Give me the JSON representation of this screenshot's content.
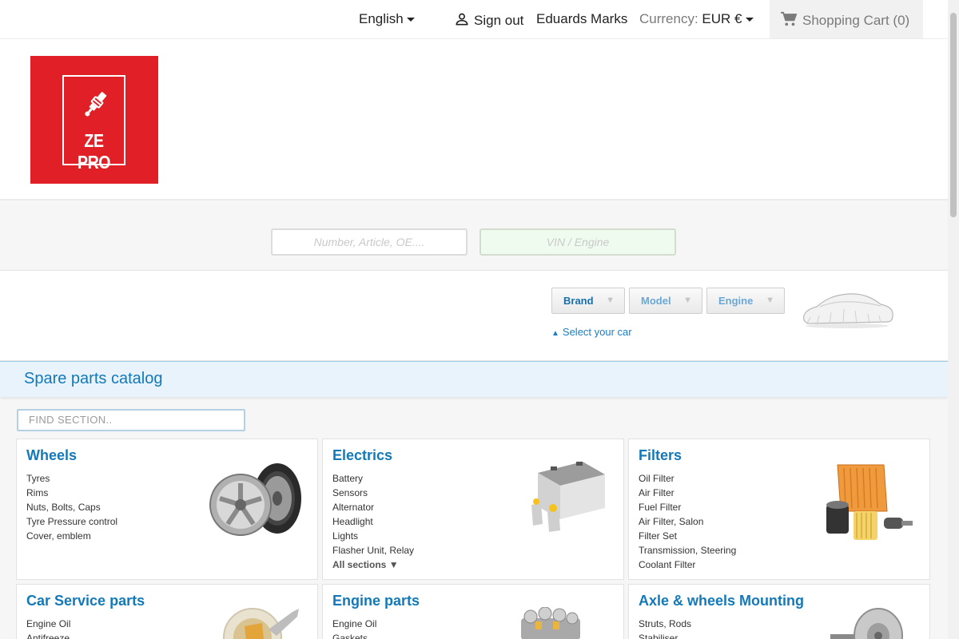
{
  "topbar": {
    "language": "English",
    "sign_out": "Sign out",
    "user_name": "Eduards Marks",
    "currency_label": "Currency:",
    "currency_value": "EUR €",
    "cart": "Shopping Cart (0)"
  },
  "logo": {
    "text": "ZE PRO",
    "bg_color": "#e01f26"
  },
  "search": {
    "number_placeholder": "Number, Article, OE....",
    "vin_placeholder": "VIN / Engine"
  },
  "car_selector": {
    "brand": "Brand",
    "model": "Model",
    "engine": "Engine",
    "select_car": "Select your car"
  },
  "catalog": {
    "title": "Spare parts catalog",
    "find_placeholder": "FIND SECTION..",
    "accent_color": "#1379b8",
    "cards": [
      {
        "title": "Wheels",
        "items": [
          "Tyres",
          "Rims",
          "Nuts, Bolts, Caps",
          "Tyre Pressure control",
          "Cover, emblem"
        ]
      },
      {
        "title": "Electrics",
        "items": [
          "Battery",
          "Sensors",
          "Alternator",
          "Headlight",
          "Lights",
          "Flasher Unit, Relay"
        ],
        "all": "All sections ▼"
      },
      {
        "title": "Filters",
        "items": [
          "Oil Filter",
          "Air Filter",
          "Fuel Filter",
          "Air Filter, Salon",
          "Filter Set",
          "Transmission, Steering",
          "Coolant Filter"
        ]
      },
      {
        "title": "Car Service parts",
        "items": [
          "Engine Oil",
          "Antifreeze"
        ]
      },
      {
        "title": "Engine parts",
        "items": [
          "Engine Oil",
          "Gaskets"
        ]
      },
      {
        "title": "Axle & wheels Mounting",
        "items": [
          "Struts, Rods",
          "Stabiliser"
        ]
      }
    ]
  }
}
